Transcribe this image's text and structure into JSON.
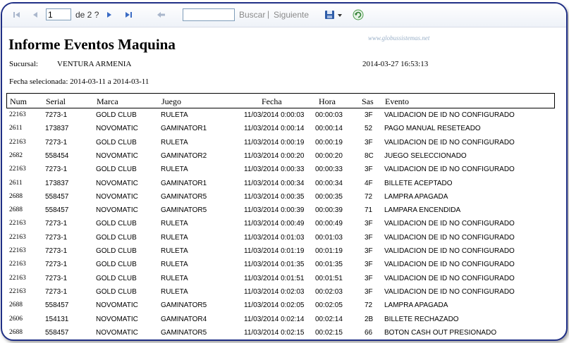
{
  "toolbar": {
    "page_value": "1",
    "of_label": "de 2 ?",
    "search_label": "Buscar",
    "separator": "|",
    "next_label": "Siguiente"
  },
  "report": {
    "title": "Informe Eventos Maquina",
    "watermark": "www.globussistemas.net",
    "sucursal_label": "Sucursal:",
    "sucursal_value": "VENTURA ARMENIA",
    "datetime": "2014-03-27 16:53:13",
    "fecha_selected": "Fecha selecionada: 2014-03-11 a 2014-03-11",
    "columns": [
      "Num",
      "Serial",
      "Marca",
      "Juego",
      "Fecha",
      "Hora",
      "Sas",
      "Evento"
    ],
    "rows": [
      [
        "22163",
        "7273-1",
        "GOLD CLUB",
        "RULETA",
        "11/03/2014 0:00:03",
        "00:00:03",
        "3F",
        "VALIDACION DE ID NO CONFIGURADO"
      ],
      [
        "2611",
        "173837",
        "NOVOMATIC",
        "GAMINATOR1",
        "11/03/2014 0:00:14",
        "00:00:14",
        "52",
        "PAGO MANUAL RESETEADO"
      ],
      [
        "22163",
        "7273-1",
        "GOLD CLUB",
        "RULETA",
        "11/03/2014 0:00:19",
        "00:00:19",
        "3F",
        "VALIDACION DE ID NO CONFIGURADO"
      ],
      [
        "2682",
        "558454",
        "NOVOMATIC",
        "GAMINATOR2",
        "11/03/2014 0:00:20",
        "00:00:20",
        "8C",
        "JUEGO SELECCIONADO"
      ],
      [
        "22163",
        "7273-1",
        "GOLD CLUB",
        "RULETA",
        "11/03/2014 0:00:33",
        "00:00:33",
        "3F",
        "VALIDACION DE ID NO CONFIGURADO"
      ],
      [
        "2611",
        "173837",
        "NOVOMATIC",
        "GAMINATOR1",
        "11/03/2014 0:00:34",
        "00:00:34",
        "4F",
        "BILLETE ACEPTADO"
      ],
      [
        "2688",
        "558457",
        "NOVOMATIC",
        "GAMINATOR5",
        "11/03/2014 0:00:35",
        "00:00:35",
        "72",
        "LAMPRA APAGADA"
      ],
      [
        "2688",
        "558457",
        "NOVOMATIC",
        "GAMINATOR5",
        "11/03/2014 0:00:39",
        "00:00:39",
        "71",
        "LAMPARA ENCENDIDA"
      ],
      [
        "22163",
        "7273-1",
        "GOLD CLUB",
        "RULETA",
        "11/03/2014 0:00:49",
        "00:00:49",
        "3F",
        "VALIDACION DE ID NO CONFIGURADO"
      ],
      [
        "22163",
        "7273-1",
        "GOLD CLUB",
        "RULETA",
        "11/03/2014 0:01:03",
        "00:01:03",
        "3F",
        "VALIDACION DE ID NO CONFIGURADO"
      ],
      [
        "22163",
        "7273-1",
        "GOLD CLUB",
        "RULETA",
        "11/03/2014 0:01:19",
        "00:01:19",
        "3F",
        "VALIDACION DE ID NO CONFIGURADO"
      ],
      [
        "22163",
        "7273-1",
        "GOLD CLUB",
        "RULETA",
        "11/03/2014 0:01:35",
        "00:01:35",
        "3F",
        "VALIDACION DE ID NO CONFIGURADO"
      ],
      [
        "22163",
        "7273-1",
        "GOLD CLUB",
        "RULETA",
        "11/03/2014 0:01:51",
        "00:01:51",
        "3F",
        "VALIDACION DE ID NO CONFIGURADO"
      ],
      [
        "22163",
        "7273-1",
        "GOLD CLUB",
        "RULETA",
        "11/03/2014 0:02:03",
        "00:02:03",
        "3F",
        "VALIDACION DE ID NO CONFIGURADO"
      ],
      [
        "2688",
        "558457",
        "NOVOMATIC",
        "GAMINATOR5",
        "11/03/2014 0:02:05",
        "00:02:05",
        "72",
        "LAMPRA APAGADA"
      ],
      [
        "2606",
        "154131",
        "NOVOMATIC",
        "GAMINATOR4",
        "11/03/2014 0:02:14",
        "00:02:14",
        "2B",
        "BILLETE RECHAZADO"
      ],
      [
        "2688",
        "558457",
        "NOVOMATIC",
        "GAMINATOR5",
        "11/03/2014 0:02:15",
        "00:02:15",
        "66",
        "BOTON CASH OUT PRESIONADO"
      ]
    ]
  }
}
